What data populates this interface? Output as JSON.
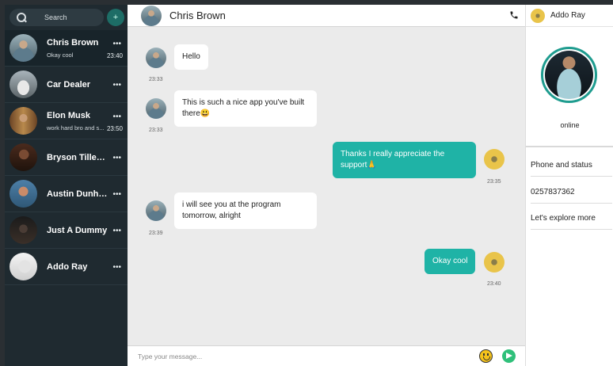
{
  "sidebar": {
    "search_label": "Search",
    "add_label": "+",
    "contacts": [
      {
        "name": "Chris Brown",
        "sub": "Okay cool",
        "time": "23:40",
        "dots": "•••"
      },
      {
        "name": "Car Dealer",
        "sub": "",
        "time": "",
        "dots": "•••"
      },
      {
        "name": "Elon Musk",
        "sub": "work hard bro and s...",
        "time": "23:50",
        "dots": "•••"
      },
      {
        "name": "Bryson Tiller (G...",
        "sub": "",
        "time": "",
        "dots": "•••"
      },
      {
        "name": "Austin Dunham",
        "sub": "",
        "time": "",
        "dots": "•••"
      },
      {
        "name": "Just A Dummy",
        "sub": "",
        "time": "",
        "dots": "•••"
      },
      {
        "name": "Addo Ray",
        "sub": "",
        "time": "",
        "dots": "•••"
      }
    ]
  },
  "chat": {
    "title": "Chris Brown",
    "messages": [
      {
        "text": "Hello",
        "time": "23:33",
        "dir": "in"
      },
      {
        "text": "This is such a nice app you've built there😃",
        "time": "23:33",
        "dir": "in"
      },
      {
        "text": "Thanks I really appreciate the support🙏",
        "time": "23:35",
        "dir": "out"
      },
      {
        "text": "i will see you at the program tomorrow, alright",
        "time": "23:39",
        "dir": "in"
      },
      {
        "text": "Okay cool",
        "time": "23:40",
        "dir": "out"
      }
    ],
    "composer_placeholder": "Type your message..."
  },
  "profile": {
    "name": "Addo Ray",
    "status": "online",
    "items": [
      "Phone and status",
      "0257837362",
      "Let's explore more"
    ]
  }
}
